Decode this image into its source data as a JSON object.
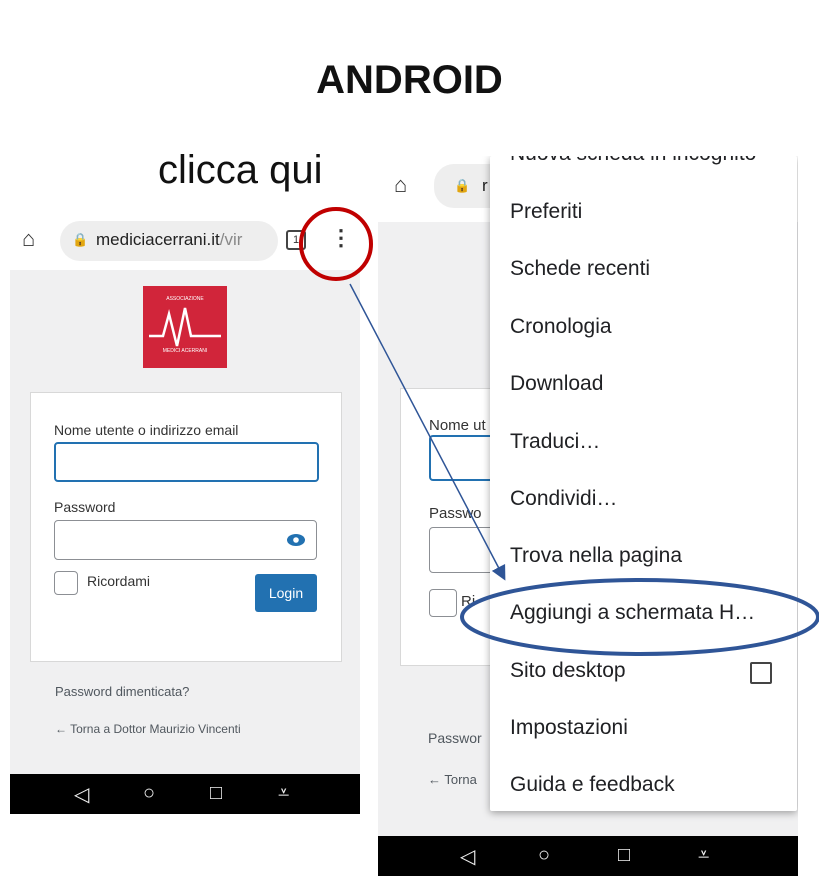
{
  "header": {
    "title": "ANDROID",
    "hint": "clicca qui"
  },
  "left_phone": {
    "url_host": "mediciacerrani.it",
    "url_path": "/vir",
    "tab_count": "1",
    "logo": {
      "top": "ASSOCIAZIONE",
      "mark": "MA",
      "bottom": "MEDICI ACERRANI"
    },
    "login_form": {
      "username_label": "Nome utente o indirizzo email",
      "username_value": "",
      "password_label": "Password",
      "password_value": "",
      "remember_label": "Ricordami",
      "login_button": "Login"
    },
    "lost_password": "Password dimenticata?",
    "back_link": "← Torna a Dottor Maurizio Vincenti"
  },
  "right_phone": {
    "url_partial": "r",
    "behind": {
      "username_label": "Nome ut",
      "password_label": "Passwo",
      "remember_label": "Ri",
      "lost_password": "Passwor",
      "back_link": "← Torna"
    },
    "menu": {
      "partial_item": "Nuova scheda in incognito",
      "items": [
        "Preferiti",
        "Schede recenti",
        "Cronologia",
        "Download",
        "Traduci…",
        "Condividi…",
        "Trova nella pagina",
        "Aggiungi a schermata H…",
        "Sito desktop",
        "Impostazioni",
        "Guida e feedback"
      ]
    }
  },
  "nav_icons": [
    "back-triangle",
    "home-circle",
    "recents-square",
    "download-arrow"
  ],
  "colors": {
    "annotation_red": "#c00000",
    "annotation_blue": "#2f5597",
    "logo_red": "#d1253a",
    "wp_blue": "#2271b1"
  }
}
